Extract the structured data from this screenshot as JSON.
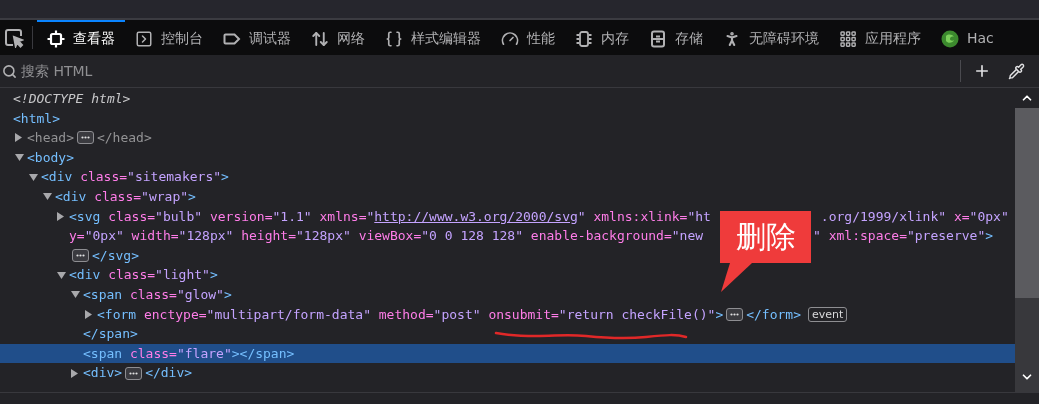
{
  "toolbar": {
    "tabs": [
      {
        "label": "查看器",
        "kind": "inspector",
        "selected": true
      },
      {
        "label": "控制台",
        "kind": "console",
        "selected": false
      },
      {
        "label": "调试器",
        "kind": "debugger",
        "selected": false
      },
      {
        "label": "网络",
        "kind": "network",
        "selected": false
      },
      {
        "label": "样式编辑器",
        "kind": "style",
        "selected": false
      },
      {
        "label": "性能",
        "kind": "performance",
        "selected": false
      },
      {
        "label": "内存",
        "kind": "memory",
        "selected": false
      },
      {
        "label": "存储",
        "kind": "storage",
        "selected": false
      },
      {
        "label": "无障碍环境",
        "kind": "accessibility",
        "selected": false
      },
      {
        "label": "应用程序",
        "kind": "application",
        "selected": false
      },
      {
        "label": "Hac",
        "kind": "extension",
        "selected": false
      }
    ]
  },
  "search": {
    "placeholder": "搜索 HTML"
  },
  "tree": [
    {
      "selected": false,
      "lines": [
        [
          {
            "kind": "doctype",
            "text": "<!DOCTYPE html>"
          }
        ]
      ]
    },
    {
      "selected": false,
      "lines": [
        [
          {
            "kind": "tag",
            "text": "<html>"
          }
        ]
      ],
      "children": [
        {
          "expanded": false,
          "selected": false,
          "lines": [
            [
              {
                "kind": "muted",
                "text": "<head>"
              },
              {
                "kind": "more"
              },
              {
                "kind": "muted",
                "text": "</head>"
              }
            ]
          ]
        },
        {
          "expanded": true,
          "selected": false,
          "lines": [
            [
              {
                "kind": "tag",
                "text": "<body>"
              }
            ]
          ],
          "children": [
            {
              "expanded": true,
              "selected": false,
              "lines": [
                [
                  {
                    "kind": "tag",
                    "text": "<div"
                  },
                  {
                    "kind": "attr",
                    "text": " class="
                  },
                  {
                    "kind": "value",
                    "text": "\"sitemakers\""
                  },
                  {
                    "kind": "tag",
                    "text": ">"
                  }
                ]
              ],
              "children": [
                {
                  "expanded": true,
                  "selected": false,
                  "lines": [
                    [
                      {
                        "kind": "tag",
                        "text": "<div"
                      },
                      {
                        "kind": "attr",
                        "text": " class="
                      },
                      {
                        "kind": "value",
                        "text": "\"wrap\""
                      },
                      {
                        "kind": "tag",
                        "text": ">"
                      }
                    ]
                  ],
                  "children": [
                    {
                      "expanded": false,
                      "selected": false,
                      "lines": [
                        [
                          {
                            "kind": "tag",
                            "text": "<svg"
                          },
                          {
                            "kind": "attr",
                            "text": " class="
                          },
                          {
                            "kind": "value",
                            "text": "\"bulb\""
                          },
                          {
                            "kind": "attr",
                            "text": " version="
                          },
                          {
                            "kind": "value",
                            "text": "\"1.1\""
                          },
                          {
                            "kind": "attr",
                            "text": " xmlns="
                          },
                          {
                            "kind": "value",
                            "text": "\""
                          },
                          {
                            "kind": "link",
                            "text": "http://www.w3.org/2000/svg"
                          },
                          {
                            "kind": "value",
                            "text": "\""
                          },
                          {
                            "kind": "attr",
                            "text": " xmlns:xlink="
                          },
                          {
                            "kind": "value",
                            "text": "\"ht"
                          },
                          {
                            "kind": "gap"
                          },
                          {
                            "kind": "value",
                            "text": ".org/1999/xlink\""
                          },
                          {
                            "kind": "attr",
                            "text": " x="
                          },
                          {
                            "kind": "value",
                            "text": "\"0px\""
                          }
                        ],
                        [
                          {
                            "kind": "attr",
                            "text": "y="
                          },
                          {
                            "kind": "value",
                            "text": "\"0px\""
                          },
                          {
                            "kind": "attr",
                            "text": " width="
                          },
                          {
                            "kind": "value",
                            "text": "\"128px\""
                          },
                          {
                            "kind": "attr",
                            "text": " height="
                          },
                          {
                            "kind": "value",
                            "text": "\"128px\""
                          },
                          {
                            "kind": "attr",
                            "text": " viewBox="
                          },
                          {
                            "kind": "value",
                            "text": "\"0 0 128 128\""
                          },
                          {
                            "kind": "attr",
                            "text": " enable-background="
                          },
                          {
                            "kind": "value",
                            "text": "\"new"
                          },
                          {
                            "kind": "gap"
                          },
                          {
                            "kind": "value",
                            "text": "\""
                          },
                          {
                            "kind": "attr",
                            "text": " xml:space="
                          },
                          {
                            "kind": "value",
                            "text": "\"preserve\""
                          },
                          {
                            "kind": "tag",
                            "text": ">"
                          }
                        ],
                        [
                          {
                            "kind": "more"
                          },
                          {
                            "kind": "tag",
                            "text": "</svg>"
                          }
                        ]
                      ]
                    },
                    {
                      "expanded": true,
                      "selected": false,
                      "lines": [
                        [
                          {
                            "kind": "tag",
                            "text": "<div"
                          },
                          {
                            "kind": "attr",
                            "text": " class="
                          },
                          {
                            "kind": "value",
                            "text": "\"light\""
                          },
                          {
                            "kind": "tag",
                            "text": ">"
                          }
                        ]
                      ],
                      "children": [
                        {
                          "expanded": true,
                          "selected": false,
                          "lines": [
                            [
                              {
                                "kind": "tag",
                                "text": "<span"
                              },
                              {
                                "kind": "attr",
                                "text": " class="
                              },
                              {
                                "kind": "value",
                                "text": "\"glow\""
                              },
                              {
                                "kind": "tag",
                                "text": ">"
                              }
                            ]
                          ],
                          "children": [
                            {
                              "expanded": false,
                              "selected": false,
                              "lines": [
                                [
                                  {
                                    "kind": "tag",
                                    "text": "<form"
                                  },
                                  {
                                    "kind": "attr",
                                    "text": " enctype="
                                  },
                                  {
                                    "kind": "value",
                                    "text": "\"multipart/form-data\""
                                  },
                                  {
                                    "kind": "attr",
                                    "text": " method="
                                  },
                                  {
                                    "kind": "value",
                                    "text": "\"post\""
                                  },
                                  {
                                    "kind": "attr",
                                    "text": " onsubmit="
                                  },
                                  {
                                    "kind": "value",
                                    "text": "\"return checkFile()\""
                                  },
                                  {
                                    "kind": "tag",
                                    "text": ">"
                                  },
                                  {
                                    "kind": "more"
                                  },
                                  {
                                    "kind": "tag",
                                    "text": "</form>"
                                  },
                                  {
                                    "kind": "event",
                                    "text": "event"
                                  }
                                ]
                              ]
                            }
                          ],
                          "close": [
                            {
                              "kind": "tag",
                              "text": "</span>"
                            }
                          ]
                        },
                        {
                          "selected": true,
                          "lines": [
                            [
                              {
                                "kind": "tag",
                                "text": "<span"
                              },
                              {
                                "kind": "attr",
                                "text": " class="
                              },
                              {
                                "kind": "value",
                                "text": "\"flare\""
                              },
                              {
                                "kind": "tag",
                                "text": "></span>"
                              }
                            ]
                          ]
                        },
                        {
                          "expanded": false,
                          "selected": false,
                          "lines": [
                            [
                              {
                                "kind": "tag",
                                "text": "<div>"
                              },
                              {
                                "kind": "more"
                              },
                              {
                                "kind": "tag",
                                "text": "</div>"
                              }
                            ]
                          ]
                        }
                      ]
                    }
                  ]
                }
              ]
            }
          ]
        }
      ]
    }
  ],
  "callout": {
    "text": "删除"
  }
}
